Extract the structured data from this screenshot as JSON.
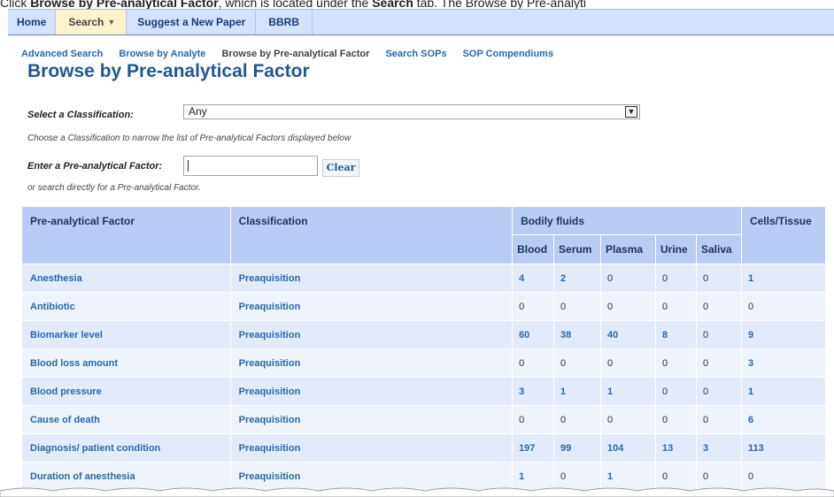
{
  "caption": {
    "prefix": "Click ",
    "bold1": "Browse by Pre-analytical Factor",
    "middle": ", which is located under the ",
    "bold2": "Search",
    "suffix": " tab. The Browse by Pre-analyti"
  },
  "nav": {
    "tabs": [
      {
        "label": "Home"
      },
      {
        "label": "Search"
      },
      {
        "label": "Suggest a New Paper"
      },
      {
        "label": "BBRB"
      }
    ],
    "caret": "▼"
  },
  "subnav": {
    "items": [
      "Advanced Search",
      "Browse by Analyte",
      "Browse by Pre-analytical Factor",
      "Search SOPs",
      "SOP Compendiums"
    ]
  },
  "page_title": "Browse by Pre-analytical Factor",
  "classification": {
    "label": "Select a Classification:",
    "value": "Any",
    "arrow": "▼",
    "hint": "Choose a Classification to narrow the list of Pre-analytical Factors displayed below"
  },
  "factor_search": {
    "label": "Enter a Pre-analytical Factor:",
    "value": "",
    "clear_label": "Clear",
    "hint": "or search directly for a Pre-analytical Factor."
  },
  "table": {
    "headers": {
      "factor": "Pre-analytical Factor",
      "classification": "Classification",
      "bodily_fluids": "Bodily fluids",
      "cells_tissue": "Cells/Tissue",
      "blood": "Blood",
      "serum": "Serum",
      "plasma": "Plasma",
      "urine": "Urine",
      "saliva": "Saliva"
    },
    "rows": [
      {
        "factor": "Anesthesia",
        "classification": "Preaquisition",
        "blood": "4",
        "serum": "2",
        "plasma": "0",
        "urine": "0",
        "saliva": "0",
        "cells": "1"
      },
      {
        "factor": "Antibiotic",
        "classification": "Preaquisition",
        "blood": "0",
        "serum": "0",
        "plasma": "0",
        "urine": "0",
        "saliva": "0",
        "cells": "0"
      },
      {
        "factor": "Biomarker level",
        "classification": "Preaquisition",
        "blood": "60",
        "serum": "38",
        "plasma": "40",
        "urine": "8",
        "saliva": "0",
        "cells": "9"
      },
      {
        "factor": "Blood loss amount",
        "classification": "Preaquisition",
        "blood": "0",
        "serum": "0",
        "plasma": "0",
        "urine": "0",
        "saliva": "0",
        "cells": "3"
      },
      {
        "factor": "Blood pressure",
        "classification": "Preaquisition",
        "blood": "3",
        "serum": "1",
        "plasma": "1",
        "urine": "0",
        "saliva": "0",
        "cells": "1"
      },
      {
        "factor": "Cause of death",
        "classification": "Preaquisition",
        "blood": "0",
        "serum": "0",
        "plasma": "0",
        "urine": "0",
        "saliva": "0",
        "cells": "6"
      },
      {
        "factor": "Diagnosis/ patient condition",
        "classification": "Preaquisition",
        "blood": "197",
        "serum": "99",
        "plasma": "104",
        "urine": "13",
        "saliva": "3",
        "cells": "113"
      },
      {
        "factor": "Duration of anesthesia",
        "classification": "Preaquisition",
        "blood": "1",
        "serum": "0",
        "plasma": "1",
        "urine": "0",
        "saliva": "0",
        "cells": "0"
      }
    ]
  }
}
